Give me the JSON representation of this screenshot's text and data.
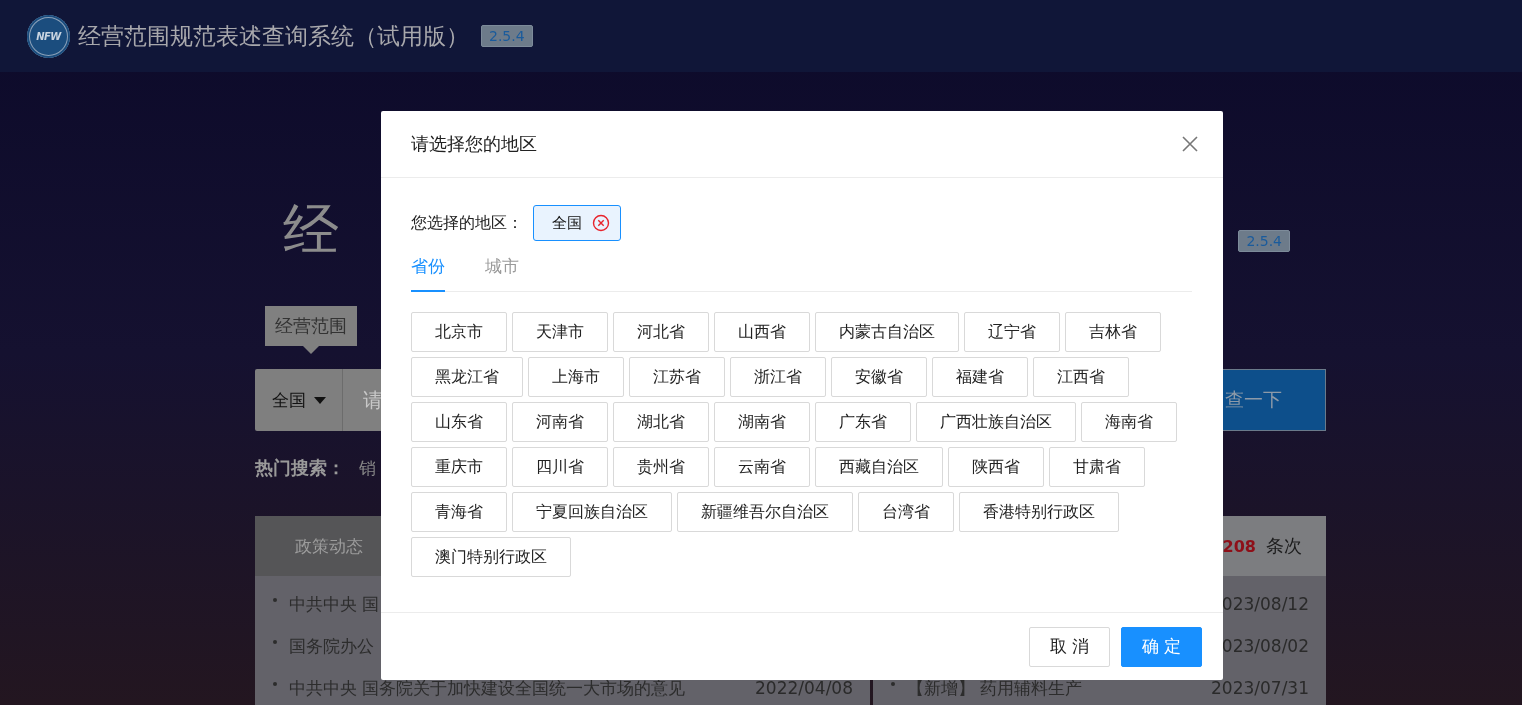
{
  "header": {
    "logo_text": "NFW",
    "title": "经营范围规范表述查询系统（试用版）",
    "version": "2.5.4"
  },
  "hero": {
    "title": "经",
    "version": "2.5.4"
  },
  "search": {
    "tooltip": "经营范围",
    "region": "全国",
    "placeholder": "请",
    "button": "查一下"
  },
  "hot_search": {
    "label": "热门搜索：",
    "items": [
      "销"
    ]
  },
  "policy_panel": {
    "tabs": [
      "政策动态"
    ],
    "rows": [
      {
        "text": "中共中央 国"
      },
      {
        "text": "国务院办公"
      },
      {
        "text": "中共中央 国务院关于加快建设全国统一大市场的意见",
        "date": "2022/04/08"
      }
    ]
  },
  "stats_panel": {
    "count": "208",
    "unit": "条次",
    "rows": [
      {
        "date": "023/08/12"
      },
      {
        "date": "023/08/02"
      },
      {
        "text": "【新增】 药用辅料生产",
        "date": "2023/07/31"
      }
    ]
  },
  "dialog": {
    "title": "请选择您的地区",
    "selected_label": "您选择的地区：",
    "selected_regions": [
      "全国"
    ],
    "tabs": [
      {
        "label": "省份",
        "selected": true
      },
      {
        "label": "城市",
        "selected": false
      }
    ],
    "regions": [
      "北京市",
      "天津市",
      "河北省",
      "山西省",
      "内蒙古自治区",
      "辽宁省",
      "吉林省",
      "黑龙江省",
      "上海市",
      "江苏省",
      "浙江省",
      "安徽省",
      "福建省",
      "江西省",
      "山东省",
      "河南省",
      "湖北省",
      "湖南省",
      "广东省",
      "广西壮族自治区",
      "海南省",
      "重庆市",
      "四川省",
      "贵州省",
      "云南省",
      "西藏自治区",
      "陕西省",
      "甘肃省",
      "青海省",
      "宁夏回族自治区",
      "新疆维吾尔自治区",
      "台湾省",
      "香港特别行政区",
      "澳门特别行政区"
    ],
    "buttons": [
      {
        "label": "取 消",
        "kind": "secondary"
      },
      {
        "label": "确 定",
        "kind": "primary"
      }
    ]
  }
}
